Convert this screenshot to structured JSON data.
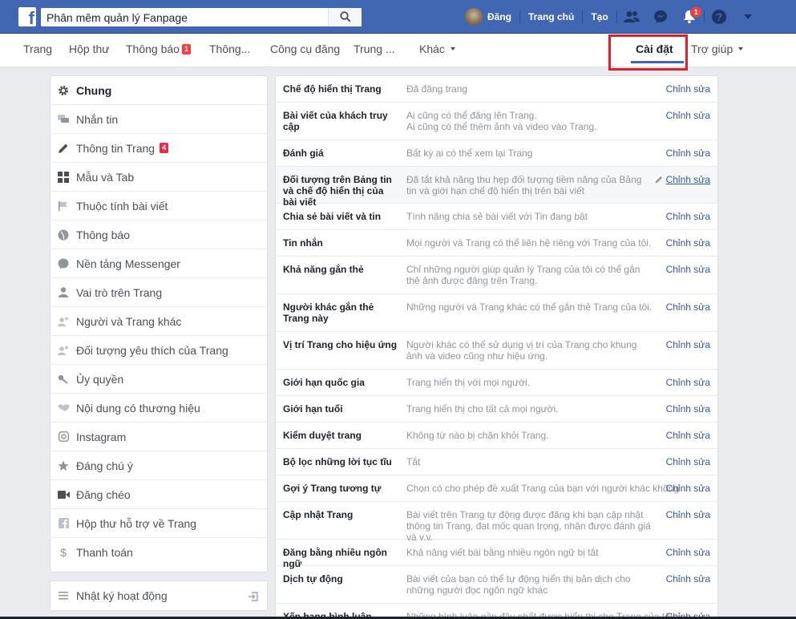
{
  "topbar": {
    "search_value": "Phân mêm quản lý Fanpage",
    "user_name": "Đăng",
    "home_label": "Trang chủ",
    "create_label": "Tạo",
    "notifications_count": "1",
    "brand_color": "#4267b2"
  },
  "page_nav": {
    "items": [
      "Trang",
      "Hộp thư",
      "Thông báo",
      "Thông...",
      "Công cụ đăng",
      "Trung ...",
      "Khác",
      "Cài đặt",
      "Trợ giúp"
    ],
    "notifications_badge": "1",
    "active": "Cài đặt"
  },
  "sidebar": {
    "items": [
      {
        "label": "Chung",
        "icon": "gear-icon"
      },
      {
        "label": "Nhắn tin",
        "icon": "chat-icon"
      },
      {
        "label": "Thông tin Trang",
        "icon": "pencil-icon",
        "badge": "4"
      },
      {
        "label": "Mẫu và Tab",
        "icon": "grid-icon"
      },
      {
        "label": "Thuộc tính bài viết",
        "icon": "flag-icon"
      },
      {
        "label": "Thông báo",
        "icon": "globe-icon"
      },
      {
        "label": "Nền tảng Messenger",
        "icon": "messenger-icon"
      },
      {
        "label": "Vai trò trên Trang",
        "icon": "person-icon"
      },
      {
        "label": "Người và Trang khác",
        "icon": "person-add-icon"
      },
      {
        "label": "Đối tượng yêu thích của Trang",
        "icon": "person-star-icon"
      },
      {
        "label": "Ủy quyền",
        "icon": "key-icon"
      },
      {
        "label": "Nội dung có thương hiệu",
        "icon": "handshake-icon"
      },
      {
        "label": "Instagram",
        "icon": "instagram-icon"
      },
      {
        "label": "Đáng chú ý",
        "icon": "star-icon"
      },
      {
        "label": "Đăng chéo",
        "icon": "video-icon"
      },
      {
        "label": "Hộp thư hỗ trợ về Trang",
        "icon": "facebook-icon"
      },
      {
        "label": "Thanh toán",
        "icon": "dollar-icon"
      }
    ],
    "activity_log": "Nhật ký hoạt động"
  },
  "settings": {
    "edit_label": "Chỉnh sửa",
    "rows": [
      {
        "label": "Chế độ hiển thị Trang",
        "value": "Đã đăng trang"
      },
      {
        "label": "Bài viết của khách truy cập",
        "value": "Ai cũng có thể đăng lên Trang.\nAi cũng có thể thêm ảnh và video vào Trang."
      },
      {
        "label": "Đánh giá",
        "value": "Bất kỳ ai có thể xem lại Trang"
      },
      {
        "label": "Đối tượng trên Bảng tin và chế độ hiển thị của bài viết",
        "value": "Đã tắt khả năng thu hẹp đối tượng tiềm năng của Bảng tin và giới hạn chế độ hiển thị trên bài viết"
      },
      {
        "label": "Chia sẻ bài viết và tin",
        "value": "Tính năng chia sẻ bài viết với Tin đang bật"
      },
      {
        "label": "Tin nhắn",
        "value": "Mọi người và Trang có thể liên hệ riêng với Trang của tôi."
      },
      {
        "label": "Khả năng gắn thẻ",
        "value": "Chỉ những người giúp quản lý Trang của tôi có thể gắn thẻ ảnh được đăng trên Trang."
      },
      {
        "label": "Người khác gắn thẻ Trang này",
        "value": "Những người và Trang khác có thể gắn thẻ Trang của tôi."
      },
      {
        "label": "Vị trí Trang cho hiệu ứng",
        "value": "Người khác có thể sử dụng vị trí của Trang cho khung ảnh và video cũng như hiệu ứng."
      },
      {
        "label": "Giới hạn quốc gia",
        "value": "Trang hiển thị với mọi người."
      },
      {
        "label": "Giới hạn tuổi",
        "value": "Trang hiển thị cho tất cả mọi người."
      },
      {
        "label": "Kiểm duyệt trang",
        "value": "Không từ nào bị chặn khỏi Trang."
      },
      {
        "label": "Bộ lọc những lời tục tĩu",
        "value": "Tắt"
      },
      {
        "label": "Gợi ý Trang tương tự",
        "value": "Chọn có cho phép đề xuất Trang của bạn với người khác không"
      },
      {
        "label": "Cập nhật Trang",
        "value": "Bài viết trên Trang tự động được đăng khi bạn cập nhật thông tin Trang, đạt mốc quan trọng, nhận được đánh giá và v.v."
      },
      {
        "label": "Đăng bằng nhiều ngôn ngữ",
        "value": "Khả năng viết bài bằng nhiều ngôn ngữ bị tắt"
      },
      {
        "label": "Dịch tự động",
        "value": "Bài viết của bạn có thể tự động hiển thị bản dịch cho những người đọc ngôn ngữ khác"
      },
      {
        "label": "Xếp hạng bình luận",
        "value": "Những bình luận gần đây nhất được hiển thị cho Trang của tôi"
      }
    ]
  }
}
